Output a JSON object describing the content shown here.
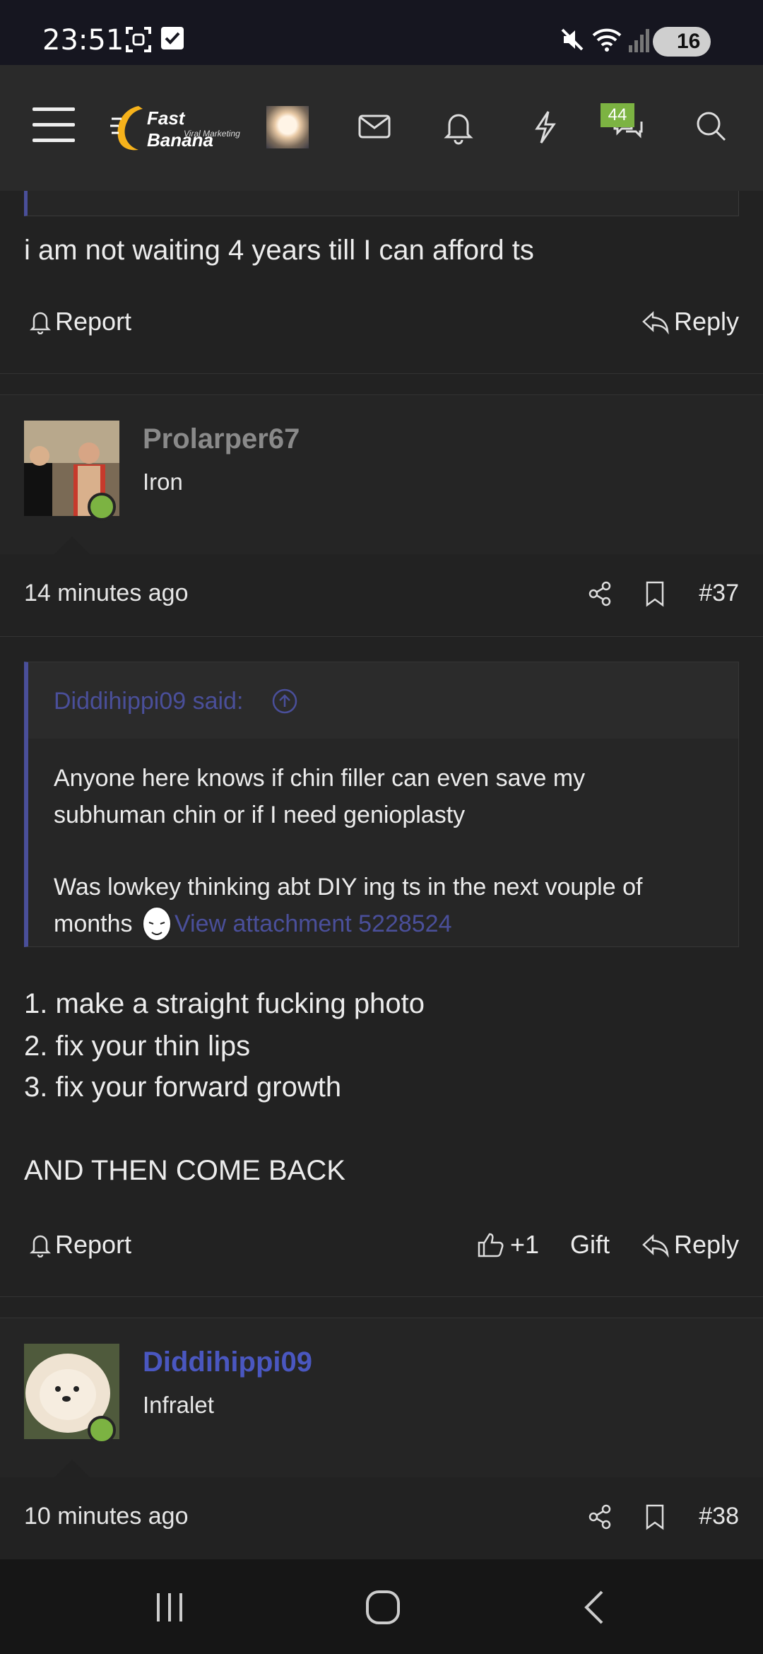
{
  "status_bar": {
    "time": "23:51",
    "battery": "16",
    "icons": [
      "screenshot-icon",
      "checkbox-icon",
      "mute-icon",
      "wifi-icon",
      "signal-icon"
    ]
  },
  "header": {
    "logo_title": "Fast Banana",
    "logo_subtitle": "Viral Marketing",
    "conversations_badge": "44",
    "icons": [
      "menu-icon",
      "mail-icon",
      "bell-icon",
      "lightning-icon",
      "chat-icon",
      "search-icon"
    ]
  },
  "post_prev": {
    "text": "i am not waiting 4 years till I can afford ts",
    "report_label": "Report",
    "reply_label": "Reply"
  },
  "post_37": {
    "username": "Prolarper67",
    "user_title": "Iron",
    "time": "14 minutes ago",
    "number": "#37",
    "quote_author": "Diddihippi09 said:",
    "quote_line1": "Anyone here knows if chin filler can even save my subhuman chin or if I need genioplasty",
    "quote_line2": "Was lowkey thinking abt DIY ing ts in the next vouple of months",
    "quote_attachment": "View attachment 5228524",
    "body_lines": [
      "1. make a straight fucking photo",
      "2. fix your thin lips",
      "3. fix your forward growth",
      "",
      "AND THEN COME BACK"
    ],
    "report_label": "Report",
    "like_label": "+1",
    "gift_label": "Gift",
    "reply_label": "Reply"
  },
  "post_38": {
    "username": "Diddihippi09",
    "user_title": "Infralet",
    "time": "10 minutes ago",
    "number": "#38"
  },
  "colors": {
    "background": "#222222",
    "accent": "#4a4f9a",
    "online": "#7cb342",
    "badge": "#7cb342"
  }
}
